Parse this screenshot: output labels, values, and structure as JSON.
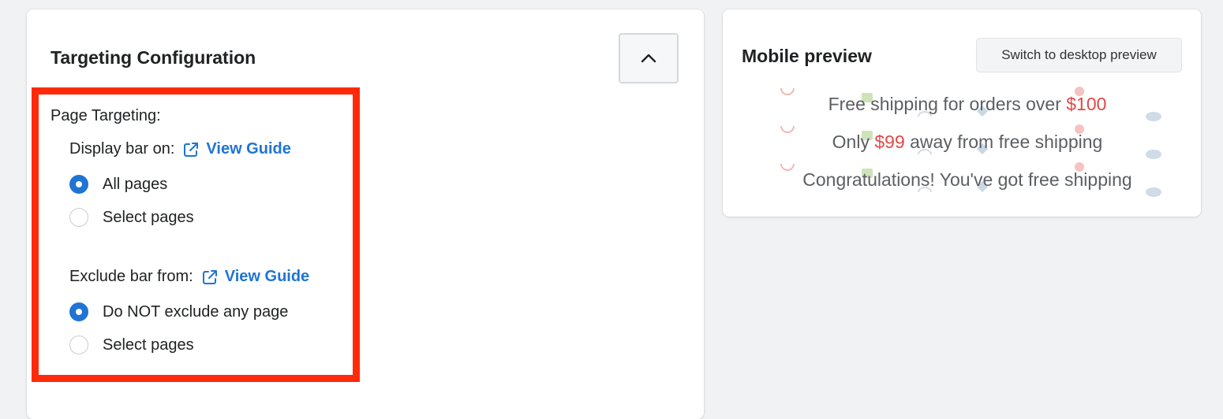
{
  "targeting": {
    "title": "Targeting Configuration",
    "section_label": "Page Targeting:",
    "display": {
      "label": "Display bar on:",
      "guide_link": "View Guide",
      "options": [
        "All pages",
        "Select pages"
      ],
      "selected_index": 0
    },
    "exclude": {
      "label": "Exclude bar from:",
      "guide_link": "View Guide",
      "options": [
        "Do NOT exclude any page",
        "Select pages"
      ],
      "selected_index": 0
    }
  },
  "preview": {
    "title": "Mobile preview",
    "switch_button": "Switch to desktop preview",
    "messages": {
      "m1_before": "Free shipping for orders over ",
      "m1_amount": "$100",
      "m2_before": "Only ",
      "m2_amount": "$99",
      "m2_after": " away from free shipping",
      "m3": "Congratulations! You've got free shipping"
    }
  },
  "colors": {
    "accent": "#1f74d4",
    "highlight": "#ff2a0a",
    "amount": "#e04949"
  },
  "icons": {
    "collapse": "chevron-up-icon",
    "guide": "external-link-icon"
  }
}
